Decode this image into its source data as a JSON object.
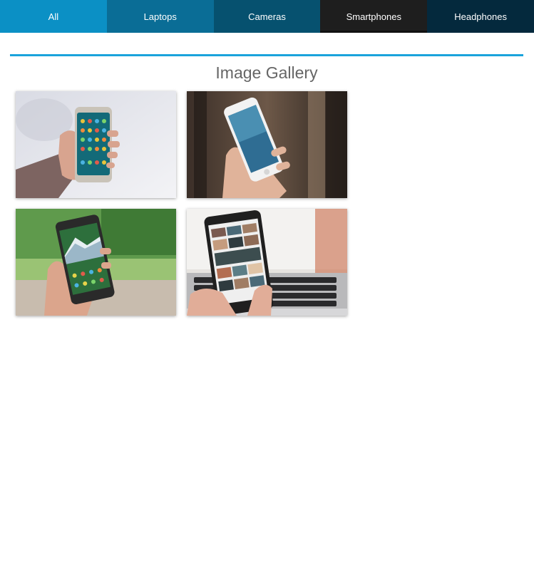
{
  "nav": {
    "tabs": [
      {
        "label": "All"
      },
      {
        "label": "Laptops"
      },
      {
        "label": "Cameras"
      },
      {
        "label": "Smartphones"
      },
      {
        "label": "Headphones"
      }
    ],
    "active_tab": "Smartphones",
    "colors": [
      "#0b90c5",
      "#0a6d96",
      "#06516f",
      "#1e1e1e",
      "#04293d"
    ]
  },
  "gallery": {
    "title": "Image Gallery",
    "accent_color": "#1aa3db",
    "images": [
      {
        "icon": "smartphone-photo-hand-white-background"
      },
      {
        "icon": "iphone-photo-hand-blurred-street"
      },
      {
        "icon": "android-photo-hand-green-park"
      },
      {
        "icon": "smartphone-photo-over-laptop"
      }
    ]
  }
}
